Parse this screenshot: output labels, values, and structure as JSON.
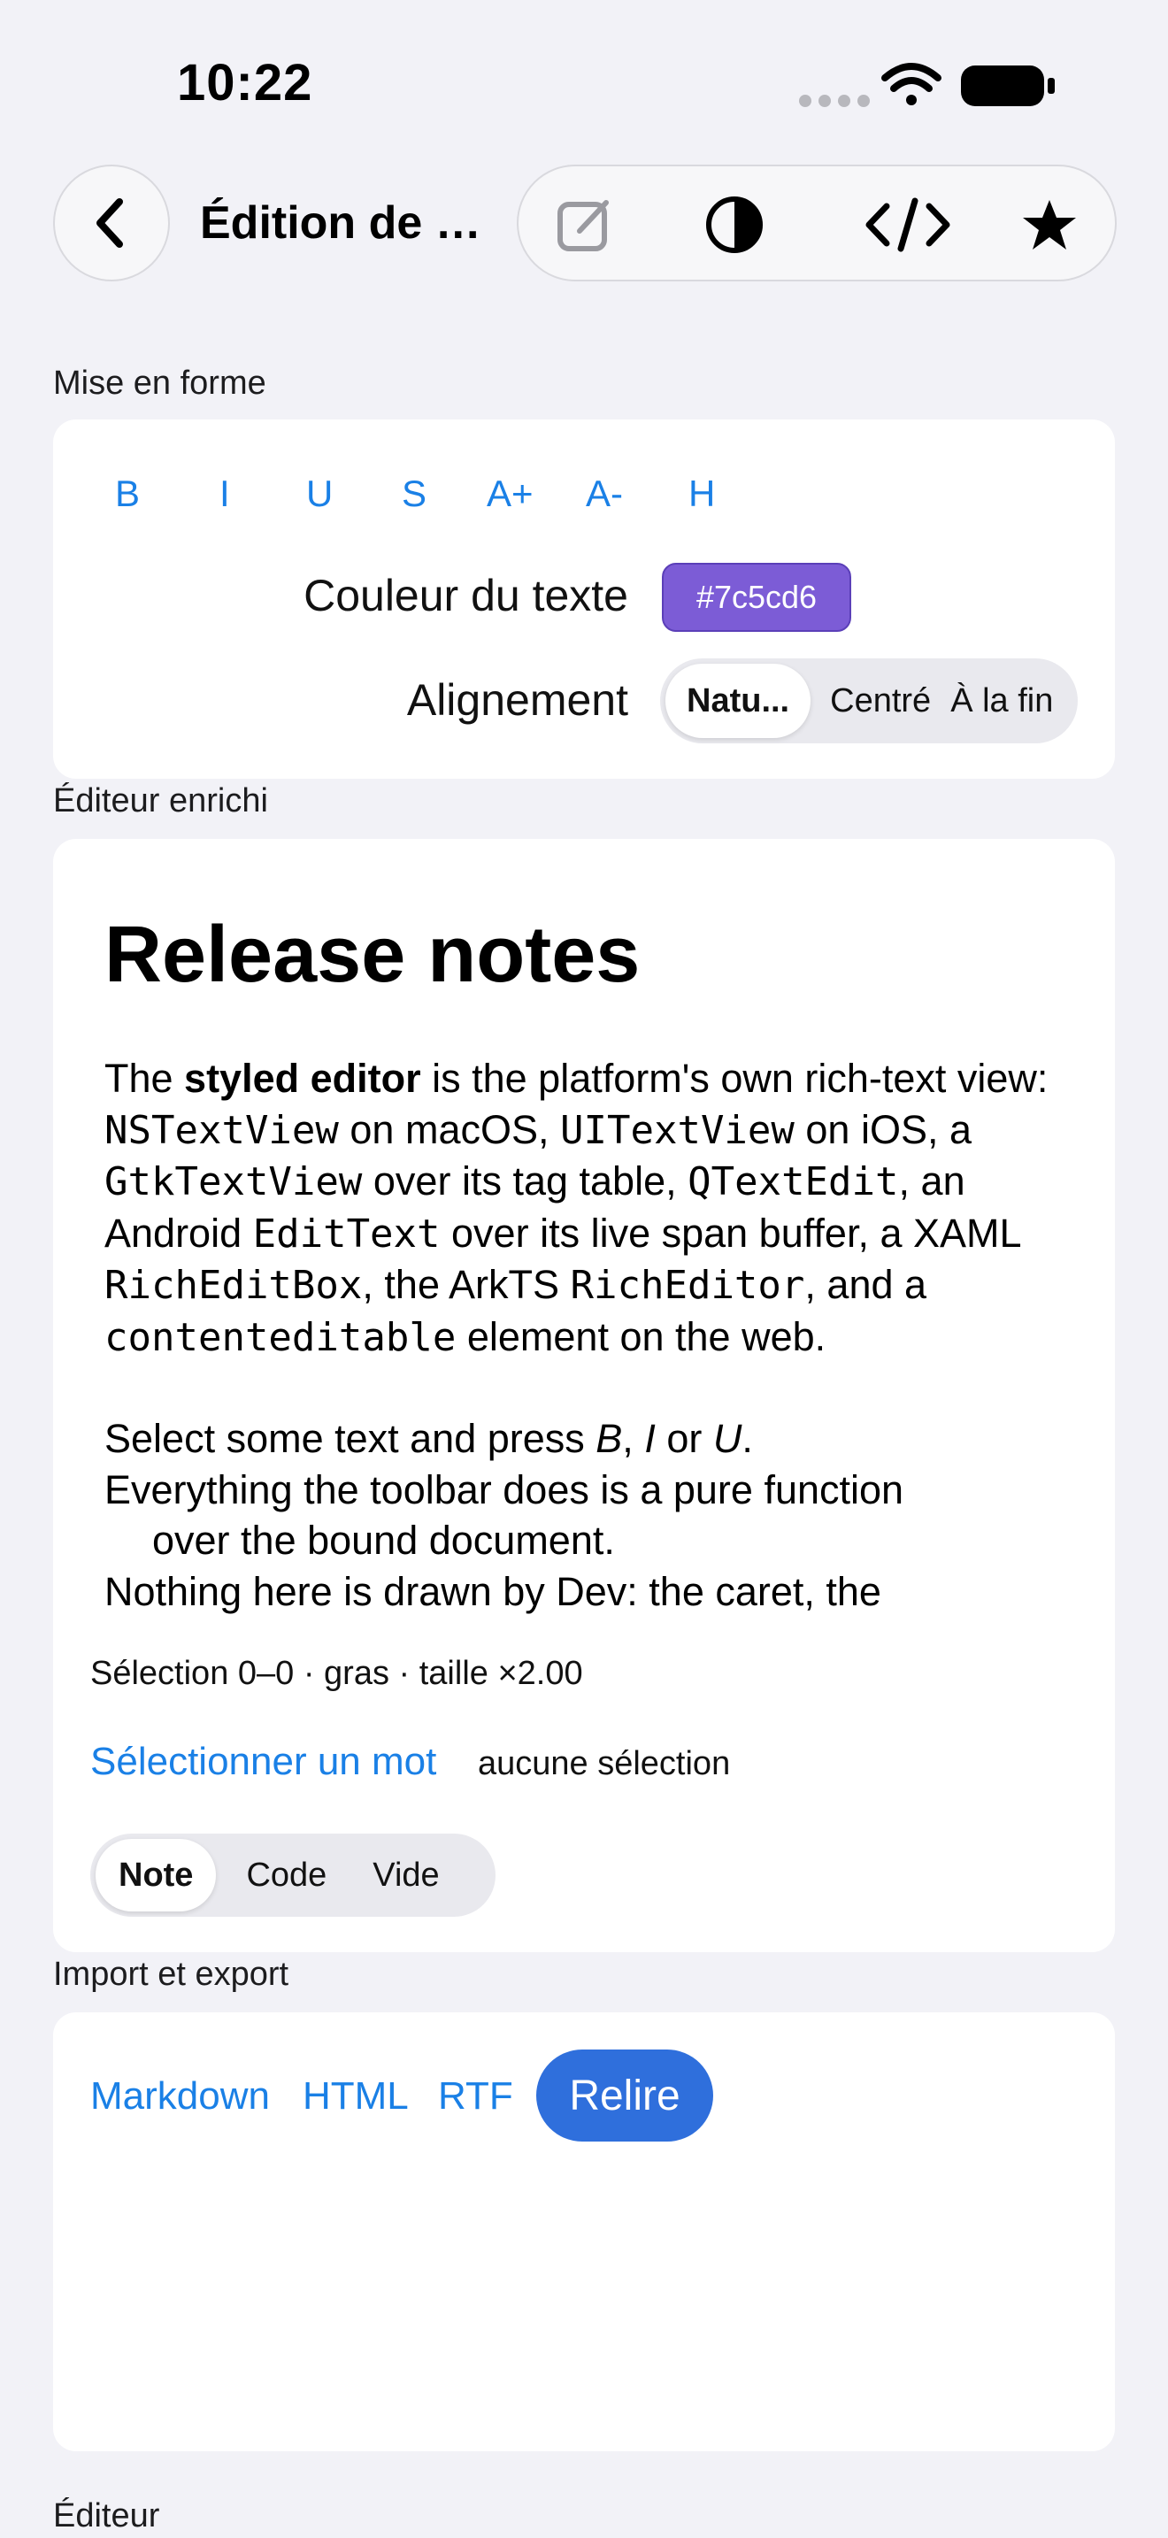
{
  "status_bar": {
    "time": "10:22",
    "icons": [
      "signal-dots-icon",
      "wifi-icon",
      "battery-icon"
    ]
  },
  "nav": {
    "title": "Édition de texte",
    "toolbar_icons": [
      "edit-icon",
      "contrast-icon",
      "code-icon",
      "star-icon"
    ]
  },
  "formatting": {
    "section_label": "Mise en forme",
    "buttons": [
      "B",
      "I",
      "U",
      "S",
      "A+",
      "A-",
      "H"
    ],
    "color_label": "Couleur du texte",
    "color_value": "#7c5cd6",
    "alignment_label": "Alignement",
    "alignment_options": [
      "Natu...",
      "Centré",
      "À la fin"
    ],
    "alignment_selected": "Natu..."
  },
  "editor": {
    "section_label": "Éditeur enrichi",
    "doc_title": "Release notes",
    "p1": {
      "t1": "The ",
      "b1": "styled editor",
      "t2": " is the platform's own rich-text view: ",
      "c1": "NSTextView",
      "t3": " on macOS, ",
      "c2": "UITextView",
      "t4": " on iOS, a ",
      "c3": "GtkTextView",
      "t5": " over its tag table, ",
      "c4": "QTextEdit",
      "t6": ", an Android ",
      "c5": "EditText",
      "t7": " over its live span buffer, a XAML ",
      "c6": "RichEditBox",
      "t8": ", the ArkTS ",
      "c7": "RichEditor",
      "t9": ", and a ",
      "c8": "contenteditable",
      "t10": " element on the web."
    },
    "p2": {
      "t1": "Select some text and press ",
      "i1": "B",
      "t2": ", ",
      "i2": "I",
      "t3": " or ",
      "i3": "U",
      "t4": "."
    },
    "p3": "Everything the toolbar does is a pure function",
    "p3b": "over the bound document.",
    "p4": "Nothing here is drawn by Dev: the caret, the",
    "selection_info": "Sélection 0–0 · gras · taille ×2.00",
    "select_word": "Sélectionner un mot",
    "no_selection": "aucune sélection",
    "mode_options": [
      "Note",
      "Code",
      "Vide"
    ],
    "mode_selected": "Note"
  },
  "import_export": {
    "section_label": "Import et export",
    "links": [
      "Markdown",
      "HTML",
      "RTF"
    ],
    "reread_label": "Relire"
  },
  "next_section_label": "Éditeur"
}
